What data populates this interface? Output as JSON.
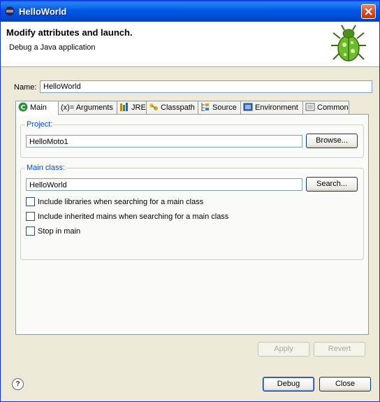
{
  "window": {
    "title": "HelloWorld"
  },
  "banner": {
    "title": "Modify attributes and launch.",
    "message": "Debug a Java application",
    "icon": "bug-icon"
  },
  "name": {
    "label": "Name:",
    "value": "HelloWorld"
  },
  "tabs": [
    {
      "label": "Main",
      "icon": "java-c-icon"
    },
    {
      "label": "Arguments",
      "icon": "variable-icon",
      "prefix": "(x)="
    },
    {
      "label": "JRE",
      "icon": "library-icon"
    },
    {
      "label": "Classpath",
      "icon": "classpath-icon"
    },
    {
      "label": "Source",
      "icon": "source-icon"
    },
    {
      "label": "Environment",
      "icon": "environment-icon"
    },
    {
      "label": "Common",
      "icon": "common-icon"
    }
  ],
  "project": {
    "label": "Project:",
    "value": "HelloMoto1",
    "browse": "Browse..."
  },
  "main_class": {
    "label": "Main class:",
    "value": "HelloWorld",
    "search": "Search..."
  },
  "options": [
    {
      "label": "Include libraries when searching for a main class",
      "checked": false
    },
    {
      "label": "Include inherited mains when searching for a main class",
      "checked": false
    },
    {
      "label": "Stop in main",
      "checked": false
    }
  ],
  "buttons": {
    "apply": "Apply",
    "revert": "Revert",
    "debug": "Debug",
    "close": "Close",
    "help": "?"
  }
}
